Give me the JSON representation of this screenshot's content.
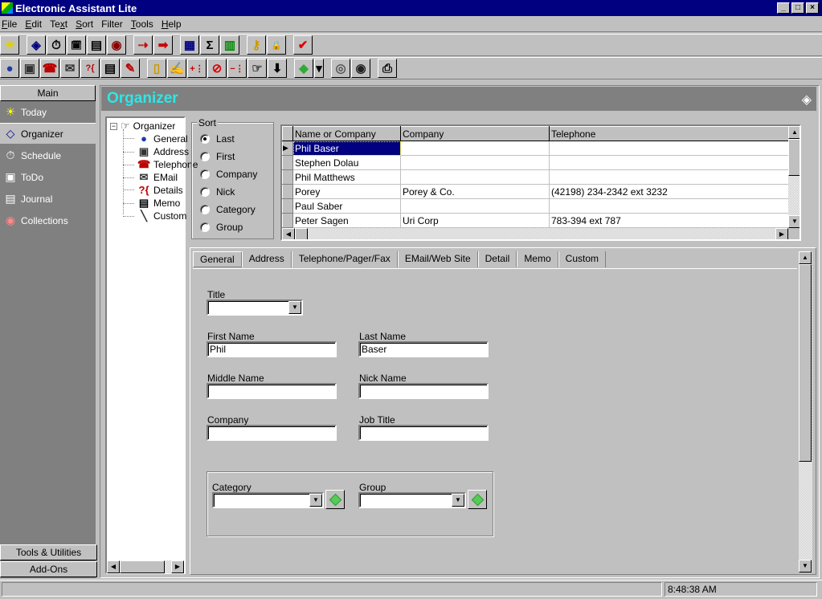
{
  "window": {
    "title": "Electronic Assistant Lite",
    "controls": [
      "_",
      "□",
      "×"
    ]
  },
  "menu": [
    {
      "label": "File",
      "key": "F"
    },
    {
      "label": "Edit",
      "key": "E"
    },
    {
      "label": "Text",
      "key": "x"
    },
    {
      "label": "Sort",
      "key": "S"
    },
    {
      "label": "Filter",
      "key": ""
    },
    {
      "label": "Tools",
      "key": "T"
    },
    {
      "label": "Help",
      "key": "H"
    }
  ],
  "toolbar1": [
    {
      "icon": "sun-icon",
      "glyph": "☀",
      "color": "#e0d000"
    },
    {
      "icon": "book-icon",
      "glyph": "◈",
      "color": "#000080"
    },
    {
      "icon": "stopwatch-icon",
      "glyph": "⏱",
      "color": "#000"
    },
    {
      "icon": "todo-clock-icon",
      "glyph": "🗓",
      "color": "#000"
    },
    {
      "icon": "journal-pages-icon",
      "glyph": "▤",
      "color": "#000"
    },
    {
      "icon": "collections-icon",
      "glyph": "◉",
      "color": "#800"
    },
    {
      "icon": "import-icon",
      "glyph": "⇢",
      "color": "#c00"
    },
    {
      "icon": "export-icon",
      "glyph": "➡",
      "color": "#c00"
    },
    {
      "icon": "calendar-grid-icon",
      "glyph": "▦",
      "color": "#000080"
    },
    {
      "icon": "sum-icon",
      "glyph": "Σ",
      "color": "#000"
    },
    {
      "icon": "books-icon",
      "glyph": "▥",
      "color": "#080"
    },
    {
      "icon": "key-icon",
      "glyph": "⚷",
      "color": "#c90"
    },
    {
      "icon": "lock-icon",
      "glyph": "🔒",
      "color": "#555"
    },
    {
      "icon": "checkmark-icon",
      "glyph": "✔",
      "color": "#d00"
    }
  ],
  "toolbar2": [
    {
      "icon": "globe-icon",
      "glyph": "●",
      "color": "#1a3caa"
    },
    {
      "icon": "address-card-icon",
      "glyph": "▣",
      "color": "#333"
    },
    {
      "icon": "telephone-icon",
      "glyph": "☎",
      "color": "#b00"
    },
    {
      "icon": "email-icon",
      "glyph": "✉",
      "color": "#333"
    },
    {
      "icon": "details-icon",
      "glyph": "?{",
      "color": "#b00"
    },
    {
      "icon": "memo-icon",
      "glyph": "▤",
      "color": "#000"
    },
    {
      "icon": "pen-icon",
      "glyph": "✎",
      "color": "#b00"
    },
    {
      "icon": "new-record-icon",
      "glyph": "▯",
      "color": "#c90"
    },
    {
      "icon": "edit-record-icon",
      "glyph": "✍",
      "color": "#333"
    },
    {
      "icon": "add-item-icon",
      "glyph": "+⋮",
      "color": "#c00"
    },
    {
      "icon": "delete-no-icon",
      "glyph": "⊘",
      "color": "#d00"
    },
    {
      "icon": "remove-item-icon",
      "glyph": "−⋮",
      "color": "#c00"
    },
    {
      "icon": "pointer-list-icon",
      "glyph": "☞",
      "color": "#333"
    },
    {
      "icon": "move-down-icon",
      "glyph": "⬇",
      "color": "#000"
    },
    {
      "icon": "green-diamond-icon",
      "glyph": "◆",
      "color": "#3a3"
    },
    {
      "icon": "dropdown-arrow-icon",
      "glyph": "▾",
      "color": "#000"
    },
    {
      "icon": "cd-icon",
      "glyph": "◎",
      "color": "#555"
    },
    {
      "icon": "record-icon",
      "glyph": "◉",
      "color": "#222"
    },
    {
      "icon": "printer-icon",
      "glyph": "⎙",
      "color": "#000"
    }
  ],
  "sidebar": {
    "header": "Main",
    "items": [
      {
        "label": "Today",
        "icon": "sun-icon",
        "glyph": "☀",
        "color": "#ff0",
        "selected": false
      },
      {
        "label": "Organizer",
        "icon": "book-icon",
        "glyph": "◇",
        "color": "#fff",
        "selected": true
      },
      {
        "label": "Schedule",
        "icon": "stopwatch-icon",
        "glyph": "⏱",
        "color": "#fff",
        "selected": false
      },
      {
        "label": "ToDo",
        "icon": "todo-clock-icon",
        "glyph": "▣",
        "color": "#fff",
        "selected": false
      },
      {
        "label": "Journal",
        "icon": "journal-pages-icon",
        "glyph": "▤",
        "color": "#fff",
        "selected": false
      },
      {
        "label": "Collections",
        "icon": "collections-icon",
        "glyph": "◉",
        "color": "#f88",
        "selected": false
      }
    ],
    "footer": [
      "Tools & Utilities",
      "Add-Ons"
    ]
  },
  "header": {
    "title": "Organizer"
  },
  "tree": {
    "root": "Organizer",
    "children": [
      {
        "label": "General",
        "glyph": "●",
        "color": "#1a3caa"
      },
      {
        "label": "Address",
        "glyph": "▣",
        "color": "#333"
      },
      {
        "label": "Telephone",
        "glyph": "☎",
        "color": "#b00"
      },
      {
        "label": "EMail",
        "glyph": "✉",
        "color": "#333"
      },
      {
        "label": "Details",
        "glyph": "?{",
        "color": "#b00"
      },
      {
        "label": "Memo",
        "glyph": "▤",
        "color": "#000"
      },
      {
        "label": "Custom",
        "glyph": "╲",
        "color": "#333"
      }
    ]
  },
  "sort": {
    "label": "Sort",
    "options": [
      {
        "label": "Last",
        "selected": true
      },
      {
        "label": "First",
        "selected": false
      },
      {
        "label": "Company",
        "selected": false
      },
      {
        "label": "Nick",
        "selected": false
      },
      {
        "label": "Category",
        "selected": false
      },
      {
        "label": "Group",
        "selected": false
      }
    ]
  },
  "grid": {
    "columns": [
      "Name or Company",
      "Company",
      "Telephone"
    ],
    "rows": [
      [
        "Phil Baser",
        "",
        ""
      ],
      [
        "Stephen Dolau",
        "",
        ""
      ],
      [
        "Phil Matthews",
        "",
        ""
      ],
      [
        "Porey",
        "Porey & Co.",
        "(42198) 234-2342 ext 3232"
      ],
      [
        "Paul Saber",
        "",
        ""
      ],
      [
        "Peter Sagen",
        " Uri Corp",
        "783-394 ext 787"
      ]
    ],
    "selected_row": 0
  },
  "tabs": [
    "General",
    "Address",
    "Telephone/Pager/Fax",
    "EMail/Web Site",
    "Detail",
    "Memo",
    "Custom"
  ],
  "active_tab": 0,
  "form": {
    "title": {
      "label": "Title",
      "value": ""
    },
    "first_name": {
      "label": "First Name",
      "value": "Phil"
    },
    "last_name": {
      "label": "Last Name",
      "value": "Baser"
    },
    "middle_name": {
      "label": "Middle Name",
      "value": ""
    },
    "nick_name": {
      "label": "Nick Name",
      "value": ""
    },
    "company": {
      "label": "Company",
      "value": ""
    },
    "job_title": {
      "label": "Job Title",
      "value": ""
    },
    "category": {
      "label": "Category",
      "value": ""
    },
    "group": {
      "label": "Group",
      "value": ""
    }
  },
  "status": {
    "time": "8:48:38 AM"
  }
}
